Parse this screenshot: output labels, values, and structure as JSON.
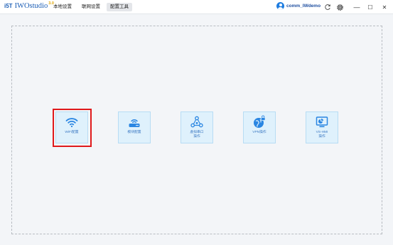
{
  "app": {
    "logo_text": "i5T",
    "name": "IWOstudio",
    "version": "3.0"
  },
  "menu": {
    "items": [
      {
        "label": "本地设置",
        "active": false
      },
      {
        "label": "联网设置",
        "active": false
      },
      {
        "label": "配置工具",
        "active": true
      }
    ]
  },
  "user": {
    "name": "comm_IWdemo"
  },
  "window_controls": {
    "refresh_icon": "refresh-icon",
    "settings_icon": "gear-icon",
    "minimize": "—",
    "maximize": "☐",
    "close": "✕"
  },
  "tools": [
    {
      "label": "WiFi配置",
      "icon": "wifi-icon",
      "selected": true
    },
    {
      "label": "模块配置",
      "icon": "router-icon",
      "selected": false
    },
    {
      "label": "虚拟串口\n操作",
      "label_lines": [
        "虚拟串口",
        "操作"
      ],
      "icon": "virtual-serial-icon",
      "selected": false
    },
    {
      "label": "VPN操作",
      "icon": "vpn-icon",
      "selected": false
    },
    {
      "label": "VS-HMI\n操作",
      "label_lines": [
        "VS-HMI",
        "操作"
      ],
      "icon": "hmi-icon",
      "selected": false
    }
  ],
  "colors": {
    "accent": "#1f7de0",
    "tile_bg": "#dff1fc",
    "selection": "#e0191b"
  }
}
